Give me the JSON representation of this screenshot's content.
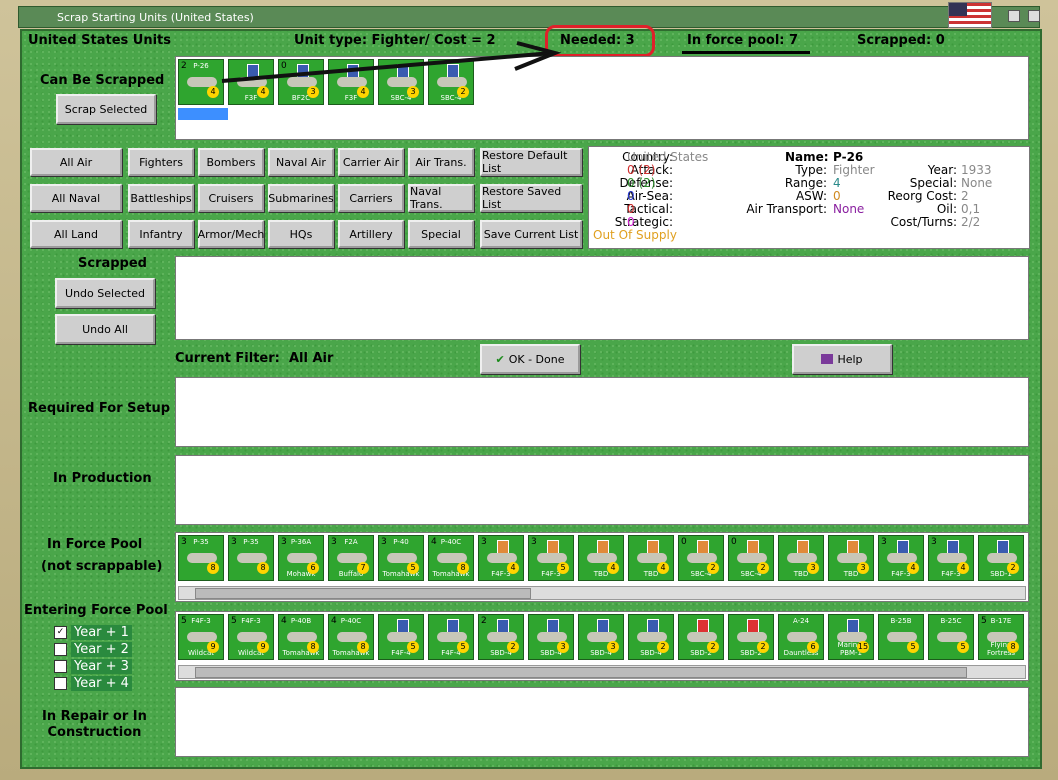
{
  "window": {
    "title": "Scrap Starting Units (United States)"
  },
  "header": {
    "country_units": "United States Units",
    "unit_type": "Unit type: Fighter/ Cost = 2",
    "needed": "Needed:  3",
    "in_force_pool": "In force pool:  7",
    "scrapped": "Scrapped:   0"
  },
  "can_be_scrapped": {
    "label": "Can Be Scrapped",
    "scrap_button": "Scrap Selected",
    "units": [
      {
        "num": "2",
        "name": "P-26",
        "val": "4",
        "top": "",
        "bl": ""
      },
      {
        "num": "",
        "name": "F3F",
        "val": "4",
        "top": "1",
        "bl": ""
      },
      {
        "num": "0",
        "name": "BF2C",
        "val": "3",
        "top": "1",
        "bl": ""
      },
      {
        "num": "",
        "name": "F3F",
        "val": "4",
        "top": "1",
        "bl": ""
      },
      {
        "num": "",
        "name": "SBC-4",
        "val": "3",
        "top": "1",
        "bl": ""
      },
      {
        "num": "",
        "name": "SBC-4",
        "val": "2",
        "top": "1",
        "bl": ""
      }
    ]
  },
  "filters": {
    "row1": [
      "All Air",
      "Fighters",
      "Bombers",
      "Naval Air",
      "Carrier Air",
      "Air Trans.",
      "Restore Default List"
    ],
    "row2": [
      "All Naval",
      "Battleships",
      "Cruisers",
      "Submarines",
      "Carriers",
      "Naval Trans.",
      "Restore Saved List"
    ],
    "row3": [
      "All Land",
      "Infantry",
      "Armor/Mech",
      "HQs",
      "Artillery",
      "Special",
      "Save Current List"
    ]
  },
  "details": {
    "col1": [
      {
        "k": "Country:",
        "v": "United States",
        "c": "#888888"
      },
      {
        "k": "Attack:",
        "v": "0 (2)",
        "c": "#d03030"
      },
      {
        "k": "Defense:",
        "v": "0 (2)",
        "c": "#2a8a2a"
      },
      {
        "k": "Air-Sea:",
        "v": "0",
        "c": "#2a3ad0"
      },
      {
        "k": "Tactical:",
        "v": "0",
        "c": "#d03030"
      },
      {
        "k": "Strategic:",
        "v": "0",
        "c": "#d020d0"
      }
    ],
    "supply": "Out Of Supply",
    "name_label": "Name:",
    "name": "P-26",
    "col2": [
      {
        "k": "Type:",
        "v": "Fighter",
        "c": "#888888"
      },
      {
        "k": "Range:",
        "v": "4",
        "c": "#2a8a8a"
      },
      {
        "k": "ASW:",
        "v": "0",
        "c": "#d08a20"
      },
      {
        "k": "Air Transport:",
        "v": "None",
        "c": "#8a20a0"
      }
    ],
    "col3": [
      {
        "k": "Year:",
        "v": "1933"
      },
      {
        "k": "Special:",
        "v": "None"
      },
      {
        "k": "Reorg Cost:",
        "v": "2"
      },
      {
        "k": "Oil:",
        "v": "0,1"
      },
      {
        "k": "Cost/Turns:",
        "v": "2/2"
      }
    ]
  },
  "scrapped_section": {
    "label": "Scrapped",
    "undo_selected": "Undo Selected",
    "undo_all": "Undo All"
  },
  "filter_row": {
    "current_filter_label": "Current Filter:",
    "current_filter": "All Air",
    "ok": "OK - Done",
    "help": "Help"
  },
  "sections": {
    "required": "Required For Setup",
    "production": "In Production",
    "force_pool_1": "In Force Pool",
    "force_pool_2": "(not scrappable)",
    "entering": "Entering Force Pool",
    "repair": "In Repair or In\nConstruction"
  },
  "force_pool_units": [
    {
      "num": "3",
      "name": "P-35",
      "val": "8",
      "sh": ""
    },
    {
      "num": "3",
      "name": "P-35",
      "val": "8",
      "sh": ""
    },
    {
      "num": "3",
      "name": "P-36A",
      "val": "6",
      "sh": "",
      "sub": "Mohawk"
    },
    {
      "num": "3",
      "name": "F2A",
      "val": "7",
      "sh": "",
      "sub": "Buffalo"
    },
    {
      "num": "3",
      "name": "P-40",
      "val": "5",
      "sh": "",
      "sub": "Tomahawk"
    },
    {
      "num": "4",
      "name": "P-40C",
      "val": "8",
      "sh": "",
      "sub": "Tomahawk"
    },
    {
      "num": "3",
      "name": "F4F-3",
      "val": "4",
      "sh": "o"
    },
    {
      "num": "3",
      "name": "F4F-3",
      "val": "5",
      "sh": "o"
    },
    {
      "num": "",
      "name": "TBD",
      "val": "4",
      "sh": "o"
    },
    {
      "num": "",
      "name": "TBD",
      "val": "4",
      "sh": "o"
    },
    {
      "num": "0",
      "name": "SBC-4",
      "val": "2",
      "sh": "o"
    },
    {
      "num": "0",
      "name": "SBC-4",
      "val": "2",
      "sh": "o"
    },
    {
      "num": "",
      "name": "TBD",
      "val": "3",
      "sh": "o"
    },
    {
      "num": "",
      "name": "TBD",
      "val": "3",
      "sh": "o"
    },
    {
      "num": "3",
      "name": "F4F-3",
      "val": "4",
      "sh": "b"
    },
    {
      "num": "3",
      "name": "F4F-3",
      "val": "4",
      "sh": "b"
    },
    {
      "num": "",
      "name": "SBD-1",
      "val": "2",
      "sh": "b"
    }
  ],
  "entering_units": [
    {
      "num": "5",
      "name": "F4F-3",
      "val": "9",
      "sh": "",
      "sub": "Wildcat"
    },
    {
      "num": "5",
      "name": "F4F-3",
      "val": "9",
      "sh": "",
      "sub": "Wildcat"
    },
    {
      "num": "4",
      "name": "P-40B",
      "val": "8",
      "sh": "",
      "sub": "Tomahawk"
    },
    {
      "num": "4",
      "name": "P-40C",
      "val": "8",
      "sh": "",
      "sub": "Tomahawk"
    },
    {
      "num": "",
      "name": "F4F-4",
      "val": "5",
      "sh": "b"
    },
    {
      "num": "",
      "name": "F4F-4",
      "val": "5",
      "sh": "b"
    },
    {
      "num": "2",
      "name": "SBD-4",
      "val": "2",
      "sh": "b"
    },
    {
      "num": "",
      "name": "SBD-4",
      "val": "3",
      "sh": "b"
    },
    {
      "num": "",
      "name": "SBD-4",
      "val": "3",
      "sh": "b"
    },
    {
      "num": "",
      "name": "SBD-4",
      "val": "2",
      "sh": "b"
    },
    {
      "num": "",
      "name": "SBD-2",
      "val": "2",
      "sh": "r"
    },
    {
      "num": "",
      "name": "SBD-2",
      "val": "2",
      "sh": "r"
    },
    {
      "num": "",
      "name": "A-24",
      "val": "6",
      "sh": "",
      "sub": "Dauntless"
    },
    {
      "num": "",
      "name": "PBM-1",
      "val": "15",
      "sh": "b",
      "sub": "Mariner"
    },
    {
      "num": "",
      "name": "B-25B",
      "val": "5",
      "sh": ""
    },
    {
      "num": "",
      "name": "B-25C",
      "val": "5",
      "sh": ""
    },
    {
      "num": "5",
      "name": "B-17E",
      "val": "8",
      "sh": "",
      "sub": "Flying Fortress"
    }
  ],
  "years": [
    {
      "label": "Year + 1",
      "checked": "✓"
    },
    {
      "label": "Year + 2",
      "checked": ""
    },
    {
      "label": "Year + 3",
      "checked": ""
    },
    {
      "label": "Year + 4",
      "checked": ""
    }
  ]
}
